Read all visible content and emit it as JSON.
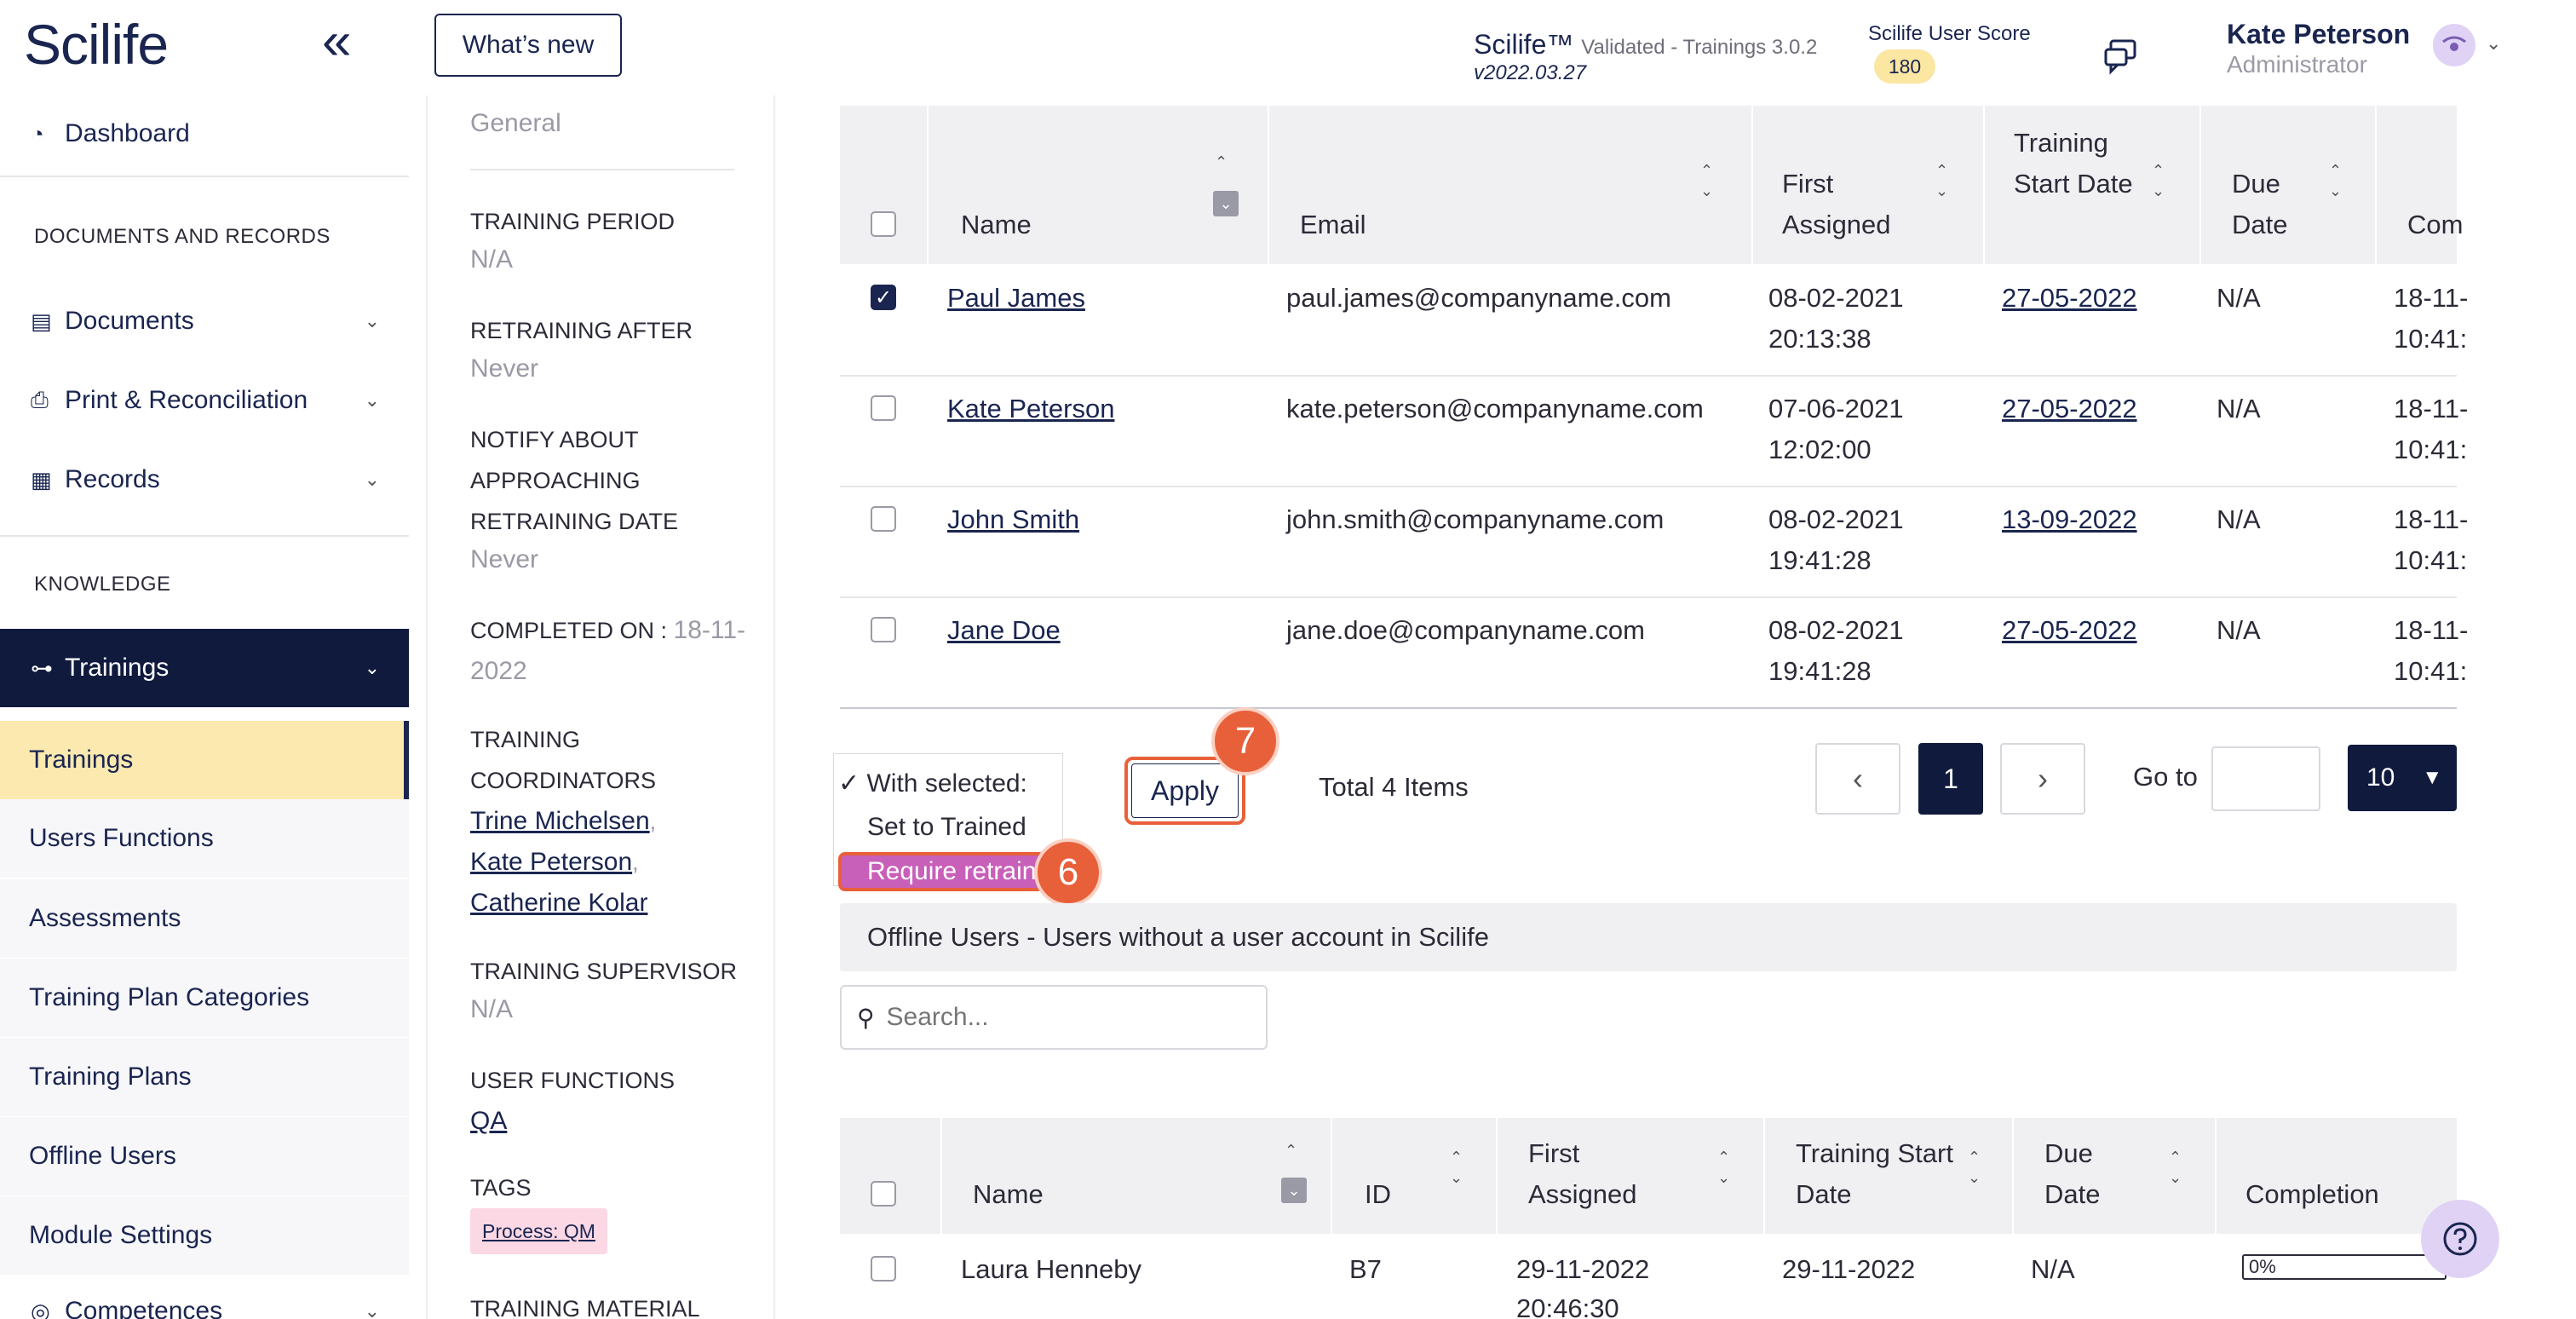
{
  "header": {
    "logo": "Scilife",
    "whats_new": "What’s new",
    "app_name": "Scilife™",
    "app_sub": "Validated - Trainings 3.0.2",
    "app_version": "v2022.03.27",
    "score_label": "Scilife User Score",
    "score_value": "180",
    "user_name": "Kate Peterson",
    "user_role": "Administrator"
  },
  "sidebar": {
    "dashboard": "Dashboard",
    "section_docs": "DOCUMENTS AND RECORDS",
    "documents": "Documents",
    "print": "Print & Reconciliation",
    "records": "Records",
    "section_knowledge": "KNOWLEDGE",
    "trainings_group": "Trainings",
    "sub_items": [
      "Trainings",
      "Users Functions",
      "Assessments",
      "Training Plan Categories",
      "Training Plans",
      "Offline Users",
      "Module Settings"
    ],
    "competences": "Competences"
  },
  "details": {
    "category_value": "General",
    "training_period_label": "TRAINING PERIOD",
    "training_period_value": "N/A",
    "retraining_label": "RETRAINING AFTER",
    "retraining_value": "Never",
    "notify_label": "NOTIFY ABOUT APPROACHING RETRAINING DATE",
    "notify_value": "Never",
    "completed_label": "COMPLETED ON :",
    "completed_value": "18-11-2022",
    "coordinators_label": "TRAINING COORDINATORS",
    "coordinators": [
      "Trine Michelsen",
      "Kate Peterson",
      "Catherine Kolar"
    ],
    "supervisor_label": "TRAINING SUPERVISOR",
    "supervisor_value": "N/A",
    "functions_label": "USER FUNCTIONS",
    "functions_value": "QA",
    "tags_label": "TAGS",
    "tag": "Process: QM",
    "material_label": "TRAINING MATERIAL"
  },
  "users_table": {
    "headers": [
      "Name",
      "Email",
      "First Assigned",
      "Training Start Date",
      "Due Date",
      "Com"
    ],
    "rows": [
      {
        "name": "Paul James",
        "email": "paul.james@companyname.com",
        "assigned": "08-02-2021",
        "assigned_time": "20:13:38",
        "start": "27-05-2022",
        "due": "N/A",
        "comp": "18-11-",
        "comp2": "10:41:",
        "checked": true
      },
      {
        "name": "Kate Peterson",
        "email": "kate.peterson@companyname.com",
        "assigned": "07-06-2021",
        "assigned_time": "12:02:00",
        "start": "27-05-2022",
        "due": "N/A",
        "comp": "18-11-",
        "comp2": "10:41:",
        "checked": false
      },
      {
        "name": "John Smith",
        "email": "john.smith@companyname.com",
        "assigned": "08-02-2021",
        "assigned_time": "19:41:28",
        "start": "13-09-2022",
        "due": "N/A",
        "comp": "18-11-",
        "comp2": "10:41:",
        "checked": false
      },
      {
        "name": "Jane Doe",
        "email": "jane.doe@companyname.com",
        "assigned": "08-02-2021",
        "assigned_time": "19:41:28",
        "start": "27-05-2022",
        "due": "N/A",
        "comp": "18-11-",
        "comp2": "10:41:",
        "checked": false
      }
    ]
  },
  "bulk": {
    "options": [
      "With selected:",
      "Set to Trained",
      "Require retraining"
    ],
    "apply": "Apply",
    "total": "Total 4 Items",
    "page": "1",
    "goto_label": "Go to",
    "page_size": "10",
    "step6": "6",
    "step7": "7"
  },
  "offline": {
    "banner": "Offline Users - Users without a user account in Scilife",
    "search_placeholder": "Search...",
    "headers": [
      "Name",
      "ID",
      "First Assigned",
      "Training Start Date",
      "Due Date",
      "Completion"
    ],
    "row": {
      "name": "Laura Henneby",
      "id": "B7",
      "assigned": "29-11-2022",
      "assigned_time": "20:46:30",
      "start": "29-11-2022",
      "due": "N/A",
      "completion": "0%"
    }
  },
  "colors": {
    "navy": "#1a2550",
    "highlight": "#fbe9b0",
    "step_badge": "#e8603a",
    "selected_option": "#c85fb8"
  }
}
